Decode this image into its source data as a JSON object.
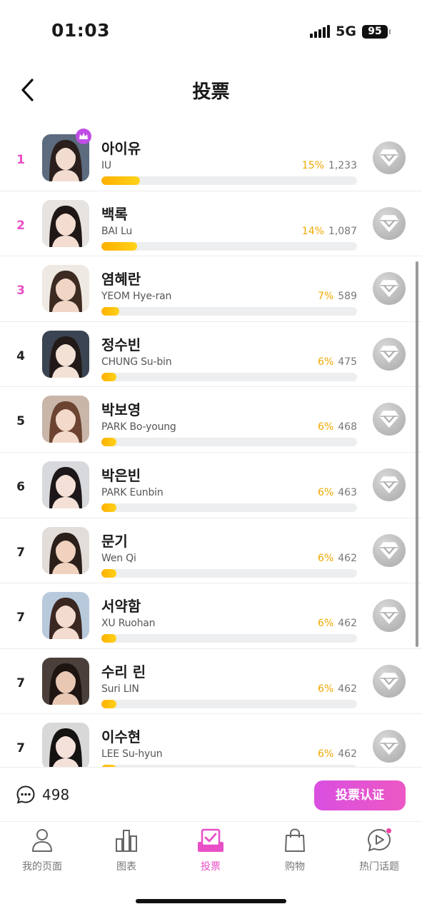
{
  "status_bar": {
    "time": "01:03",
    "network": "5G",
    "battery": "95"
  },
  "header": {
    "title": "投票"
  },
  "candidates": [
    {
      "rank": "1",
      "name_ko": "아이유",
      "name_en": "IU",
      "pct": "15%",
      "votes": "1,233",
      "share": 15,
      "avatar_bg": "#5c6b7e",
      "skin": "#f2dbcf",
      "hair": "#2a1f1c"
    },
    {
      "rank": "2",
      "name_ko": "백록",
      "name_en": "BAI Lu",
      "pct": "14%",
      "votes": "1,087",
      "share": 14,
      "avatar_bg": "#e6e3e1",
      "skin": "#f3dcd0",
      "hair": "#1f1715"
    },
    {
      "rank": "3",
      "name_ko": "염혜란",
      "name_en": "YEOM Hye-ran",
      "pct": "7%",
      "votes": "589",
      "share": 7,
      "avatar_bg": "#efe9e3",
      "skin": "#f1d6c6",
      "hair": "#3d2b22"
    },
    {
      "rank": "4",
      "name_ko": "정수빈",
      "name_en": "CHUNG Su-bin",
      "pct": "6%",
      "votes": "475",
      "share": 6,
      "avatar_bg": "#3b4452",
      "skin": "#f4e1d6",
      "hair": "#221a18"
    },
    {
      "rank": "5",
      "name_ko": "박보영",
      "name_en": "PARK Bo-young",
      "pct": "6%",
      "votes": "468",
      "share": 6,
      "avatar_bg": "#c9b6a8",
      "skin": "#f3d9ca",
      "hair": "#6b4330"
    },
    {
      "rank": "6",
      "name_ko": "박은빈",
      "name_en": "PARK Eunbin",
      "pct": "6%",
      "votes": "463",
      "share": 6,
      "avatar_bg": "#d7d9dc",
      "skin": "#f4e0d6",
      "hair": "#1d1719"
    },
    {
      "rank": "7",
      "name_ko": "문기",
      "name_en": "Wen Qi",
      "pct": "6%",
      "votes": "462",
      "share": 6,
      "avatar_bg": "#e2ddd8",
      "skin": "#f0d2bf",
      "hair": "#2b1f1a"
    },
    {
      "rank": "7",
      "name_ko": "서약함",
      "name_en": "XU Ruohan",
      "pct": "6%",
      "votes": "462",
      "share": 6,
      "avatar_bg": "#b9c9dc",
      "skin": "#f3dccf",
      "hair": "#3a2721"
    },
    {
      "rank": "7",
      "name_ko": "수리 린",
      "name_en": "Suri LIN",
      "pct": "6%",
      "votes": "462",
      "share": 6,
      "avatar_bg": "#4a3f3a",
      "skin": "#e9c8b3",
      "hair": "#1e1513"
    },
    {
      "rank": "7",
      "name_ko": "이수현",
      "name_en": "LEE Su-hyun",
      "pct": "6%",
      "votes": "462",
      "share": 6,
      "avatar_bg": "#d8d8d8",
      "skin": "#f4e2da",
      "hair": "#151212"
    }
  ],
  "footer": {
    "comment_count": "498",
    "verify_label": "投票认证"
  },
  "tabs": [
    {
      "label": "我的页面",
      "icon": "person-icon",
      "active": false
    },
    {
      "label": "图表",
      "icon": "chart-icon",
      "active": false
    },
    {
      "label": "投票",
      "icon": "vote-icon",
      "active": true
    },
    {
      "label": "购物",
      "icon": "shopping-bag-icon",
      "active": false
    },
    {
      "label": "热门话题",
      "icon": "chat-play-icon",
      "active": false
    }
  ],
  "colors": {
    "accent": "#e94fc7",
    "bar": "#ffb000",
    "percent": "#f0a800"
  }
}
